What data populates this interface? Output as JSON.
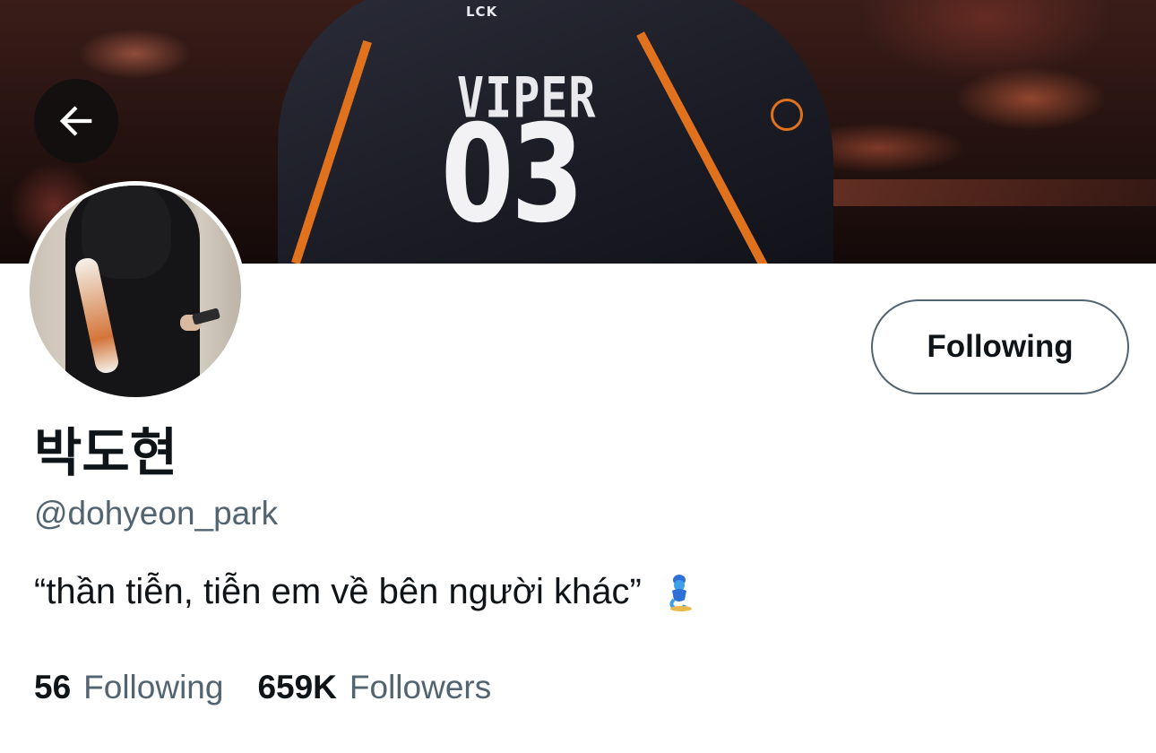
{
  "banner": {
    "jersey_league_logo": "LCK",
    "jersey_name": "VIPER",
    "jersey_number": "03"
  },
  "header": {
    "back_icon": "arrow-left-icon"
  },
  "profile": {
    "display_name": "박도현",
    "handle": "@dohyeon_park",
    "bio": "“thần tiễn, tiễn em về bên người khác”",
    "bio_emoji": "genie-icon",
    "follow_button_label": "Following"
  },
  "stats": {
    "following_count": "56",
    "following_label": "Following",
    "followers_count": "659K",
    "followers_label": "Followers"
  },
  "colors": {
    "primary_text": "#0f1419",
    "secondary_text": "#536471",
    "jersey_accent": "#e0721e"
  }
}
